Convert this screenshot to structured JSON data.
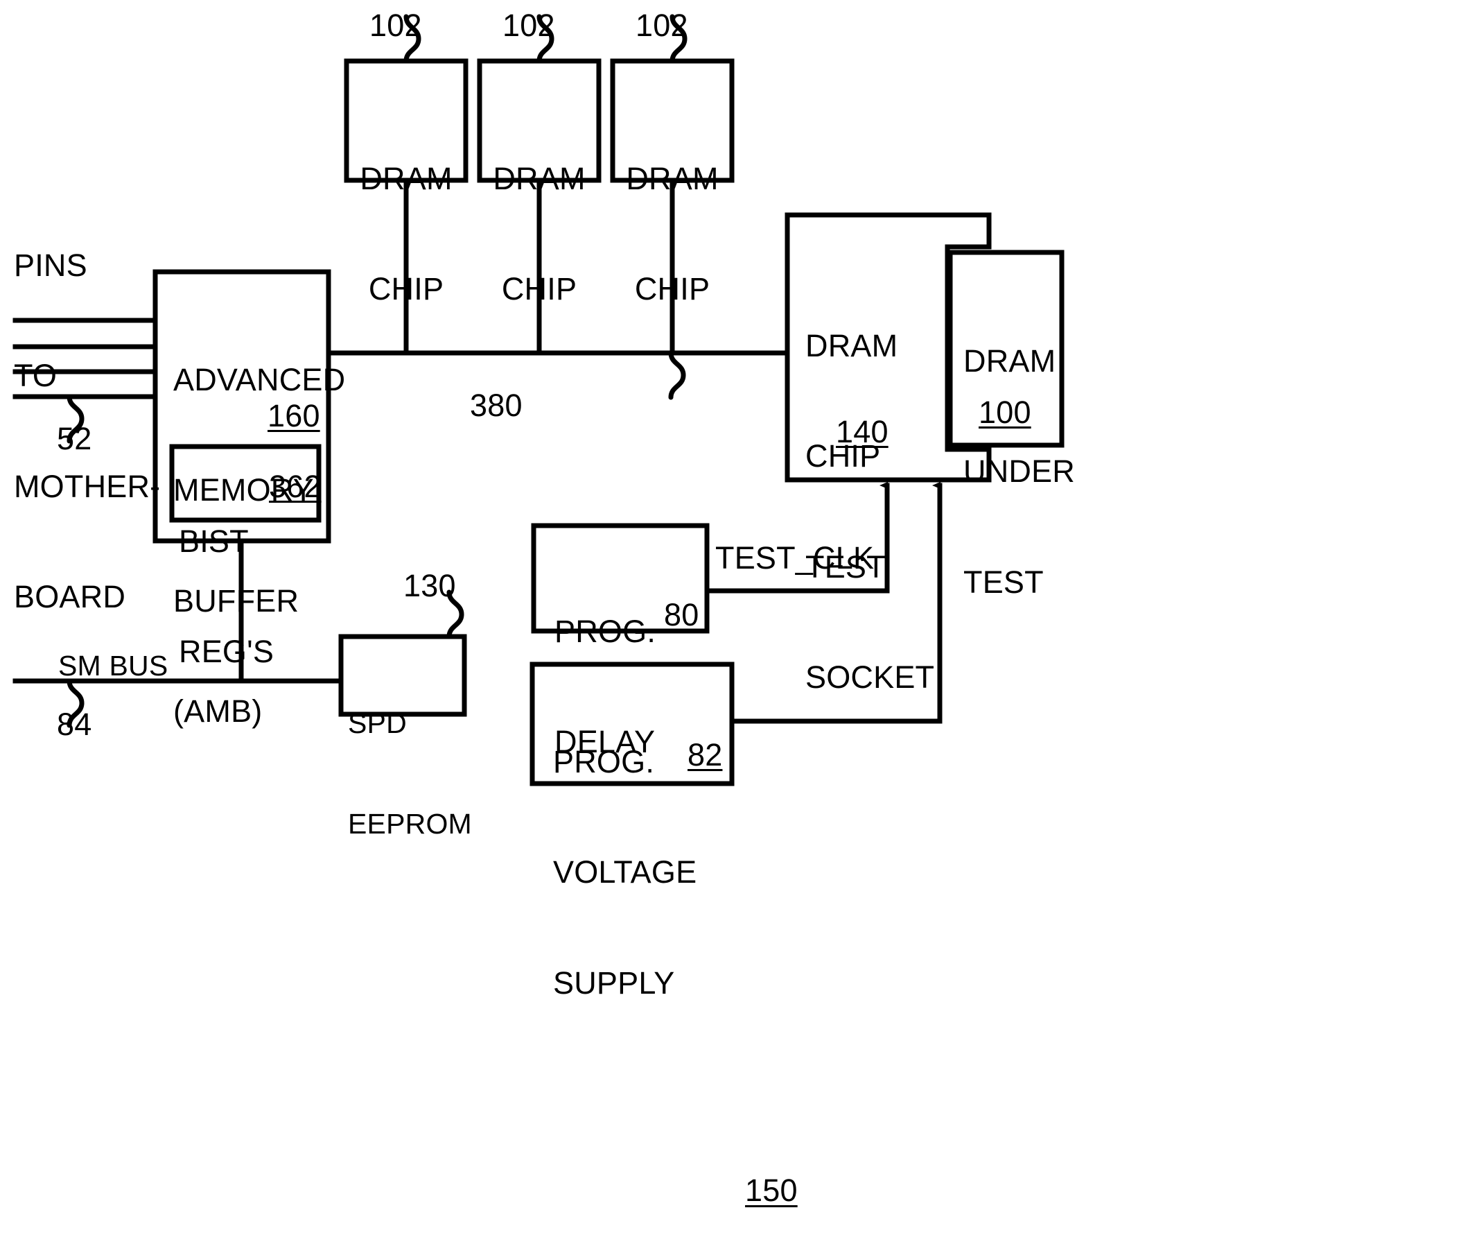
{
  "figure": {
    "number": "150",
    "type": "patent-block-diagram",
    "background_color": "#ffffff",
    "line_color": "#000000"
  },
  "blocks": {
    "dram_chip_1": {
      "lines": [
        "DRAM",
        "CHIP"
      ],
      "ref": "102"
    },
    "dram_chip_2": {
      "lines": [
        "DRAM",
        "CHIP"
      ],
      "ref": "102"
    },
    "dram_chip_3": {
      "lines": [
        "DRAM",
        "CHIP"
      ],
      "ref": "102"
    },
    "amb": {
      "line1": "ADVANCED",
      "line2": "MEMORY",
      "line3": "BUFFER",
      "line4": "(AMB)",
      "ref": "160"
    },
    "bist_regs": {
      "line1": "BIST",
      "line2": "REG'S",
      "ref": "362"
    },
    "spd_eeprom": {
      "line1": "SPD",
      "line2": "EEPROM",
      "ref": "130"
    },
    "test_socket": {
      "line1": "DRAM",
      "line2": "CHIP",
      "line3": "TEST",
      "line4": "SOCKET",
      "ref": "140"
    },
    "dram_under_test": {
      "line1": "DRAM",
      "line2": "UNDER",
      "line3": "TEST",
      "ref": "100"
    },
    "prog_delay": {
      "line1": "PROG.",
      "line2": "DELAY",
      "ref": "80"
    },
    "prog_voltage_supply": {
      "line1": "PROG.",
      "line2": "VOLTAGE",
      "line3": "SUPPLY",
      "ref": "82"
    }
  },
  "labels": {
    "pins_to_motherboard": {
      "line1": "PINS",
      "line2": "TO",
      "line3": "MOTHER-",
      "line4": "BOARD"
    },
    "pins_ref": "52",
    "memory_bus_ref": "380",
    "sm_bus": "SM BUS",
    "sm_bus_ref": "84",
    "test_clk": "TEST_CLK"
  }
}
